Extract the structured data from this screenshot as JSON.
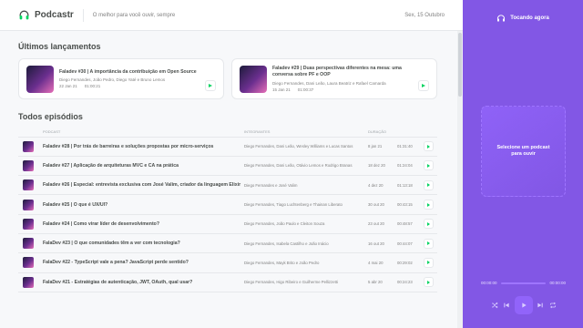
{
  "header": {
    "app_name": "Podcastr",
    "slogan": "O melhor para você ouvir, sempre",
    "date": "Sex, 15 Outubro"
  },
  "latest": {
    "title": "Últimos lançamentos",
    "episodes": [
      {
        "title": "Faladev #30 | A importância da contribuição em Open Source",
        "members": "Diego Fernandes, João Pedro, Diego Yaté e Bruno Lemos",
        "date": "22 Jan 21",
        "duration": "01:00:21"
      },
      {
        "title": "Faladev #29 | Duas perspectivas diferentes na mesa: uma conversa sobre PF e OOP",
        "members": "Diego Fernandes, Dani Leão, Laura Beatriz e Rafael Camarda",
        "date": "15 Jan 21",
        "duration": "01:00:37"
      }
    ]
  },
  "all": {
    "title": "Todos episódios",
    "columns": [
      "",
      "Podcast",
      "Integrantes",
      "Duração",
      "",
      ""
    ],
    "episodes": [
      {
        "title": "Faladev #28 | Por trás de barreiras e soluções propostas por micro-serviços",
        "members": "Diego Fernandes, Dani Leão, Wesley Williams e Lucas Santos",
        "date": "8 jan 21",
        "duration": "01:31:40"
      },
      {
        "title": "Faladev #27 | Aplicação de arquiteturas MVC e CA na prática",
        "members": "Diego Fernandes, Dani Leão, Otávio Lemos e Rodrigo Branas",
        "date": "18 dez 20",
        "duration": "01:24:04"
      },
      {
        "title": "Faladev #26 | Especial: entrevista exclusiva com José Valim, criador da linguagem Elixir",
        "members": "Diego Fernandes e José Valim",
        "date": "4 dez 20",
        "duration": "01:13:18"
      },
      {
        "title": "Faladev #25 | O que é UX/UI?",
        "members": "Diego Fernandes, Tiago Luchtenberg e Thainan Liberato",
        "date": "30 out 20",
        "duration": "00:43:15"
      },
      {
        "title": "Faladev #24 | Como virar líder de desenvolvimento?",
        "members": "Diego Fernandes, João Paulo e Cleiton Souza",
        "date": "23 out 20",
        "duration": "00:48:57"
      },
      {
        "title": "FalaDev #23 | O que comunidades têm a ver com tecnologia?",
        "members": "Diego Fernandes, Isabela Castilho e João Inácio",
        "date": "16 out 20",
        "duration": "00:44:07"
      },
      {
        "title": "FalaDev #22 - TypeScript vale a pena? JavaScript perde sentido?",
        "members": "Diego Fernandes, Mayk Brito e João Pedro",
        "date": "4 mai 20",
        "duration": "00:29:02"
      },
      {
        "title": "FalaDev #21 - Estratégias de autenticação, JWT, OAuth, qual usar?",
        "members": "Diego Fernandes, Higo Ribeiro e Guilherme Pellizzetti",
        "date": "5 abr 20",
        "duration": "00:24:23"
      }
    ]
  },
  "player": {
    "heading": "Tocando agora",
    "empty_text": "Selecione um podcast para ouvir",
    "current_time": "00:00:00",
    "total_time": "00:00:00"
  },
  "colors": {
    "accent": "#8257e5",
    "green": "#04d361"
  },
  "icons": {
    "logo": "headphones-icon",
    "player_heading": "headphones-icon",
    "play": "play-icon",
    "shuffle": "shuffle-icon",
    "previous": "skip-previous-icon",
    "next": "skip-next-icon",
    "repeat": "repeat-icon"
  }
}
